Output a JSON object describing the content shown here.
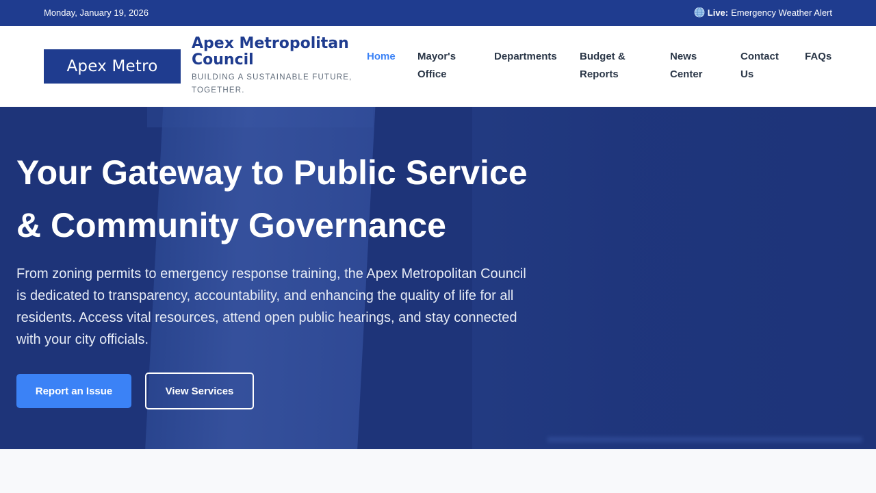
{
  "topbar": {
    "date": "Monday, January 19, 2026",
    "alert_prefix": "Live:",
    "alert_text": "Emergency Weather Alert",
    "alert_icon": "globe-icon"
  },
  "header": {
    "logo_text": "Apex Metro",
    "brand_name": "Apex Metropolitan Council",
    "tagline": "BUILDING A SUSTAINABLE FUTURE, TOGETHER."
  },
  "nav": {
    "items": [
      {
        "label": "Home",
        "active": true
      },
      {
        "label": "Mayor's Office"
      },
      {
        "label": "Departments"
      },
      {
        "label": "Budget & Reports"
      },
      {
        "label": "News Center"
      },
      {
        "label": "Contact Us"
      },
      {
        "label": "FAQs"
      }
    ]
  },
  "hero": {
    "title": "Your Gateway to Public Service & Community Governance",
    "description": "From zoning permits to emergency response training, the Apex Metropolitan Council is dedicated to transparency, accountability, and enhancing the quality of life for all residents. Access vital resources, attend open public hearings, and stay connected with your city officials.",
    "primary_button": "Report an Issue",
    "secondary_button": "View Services"
  },
  "colors": {
    "brand": "#1f3c8f",
    "accent": "#3b82f6",
    "nav_text": "#2b3748"
  }
}
